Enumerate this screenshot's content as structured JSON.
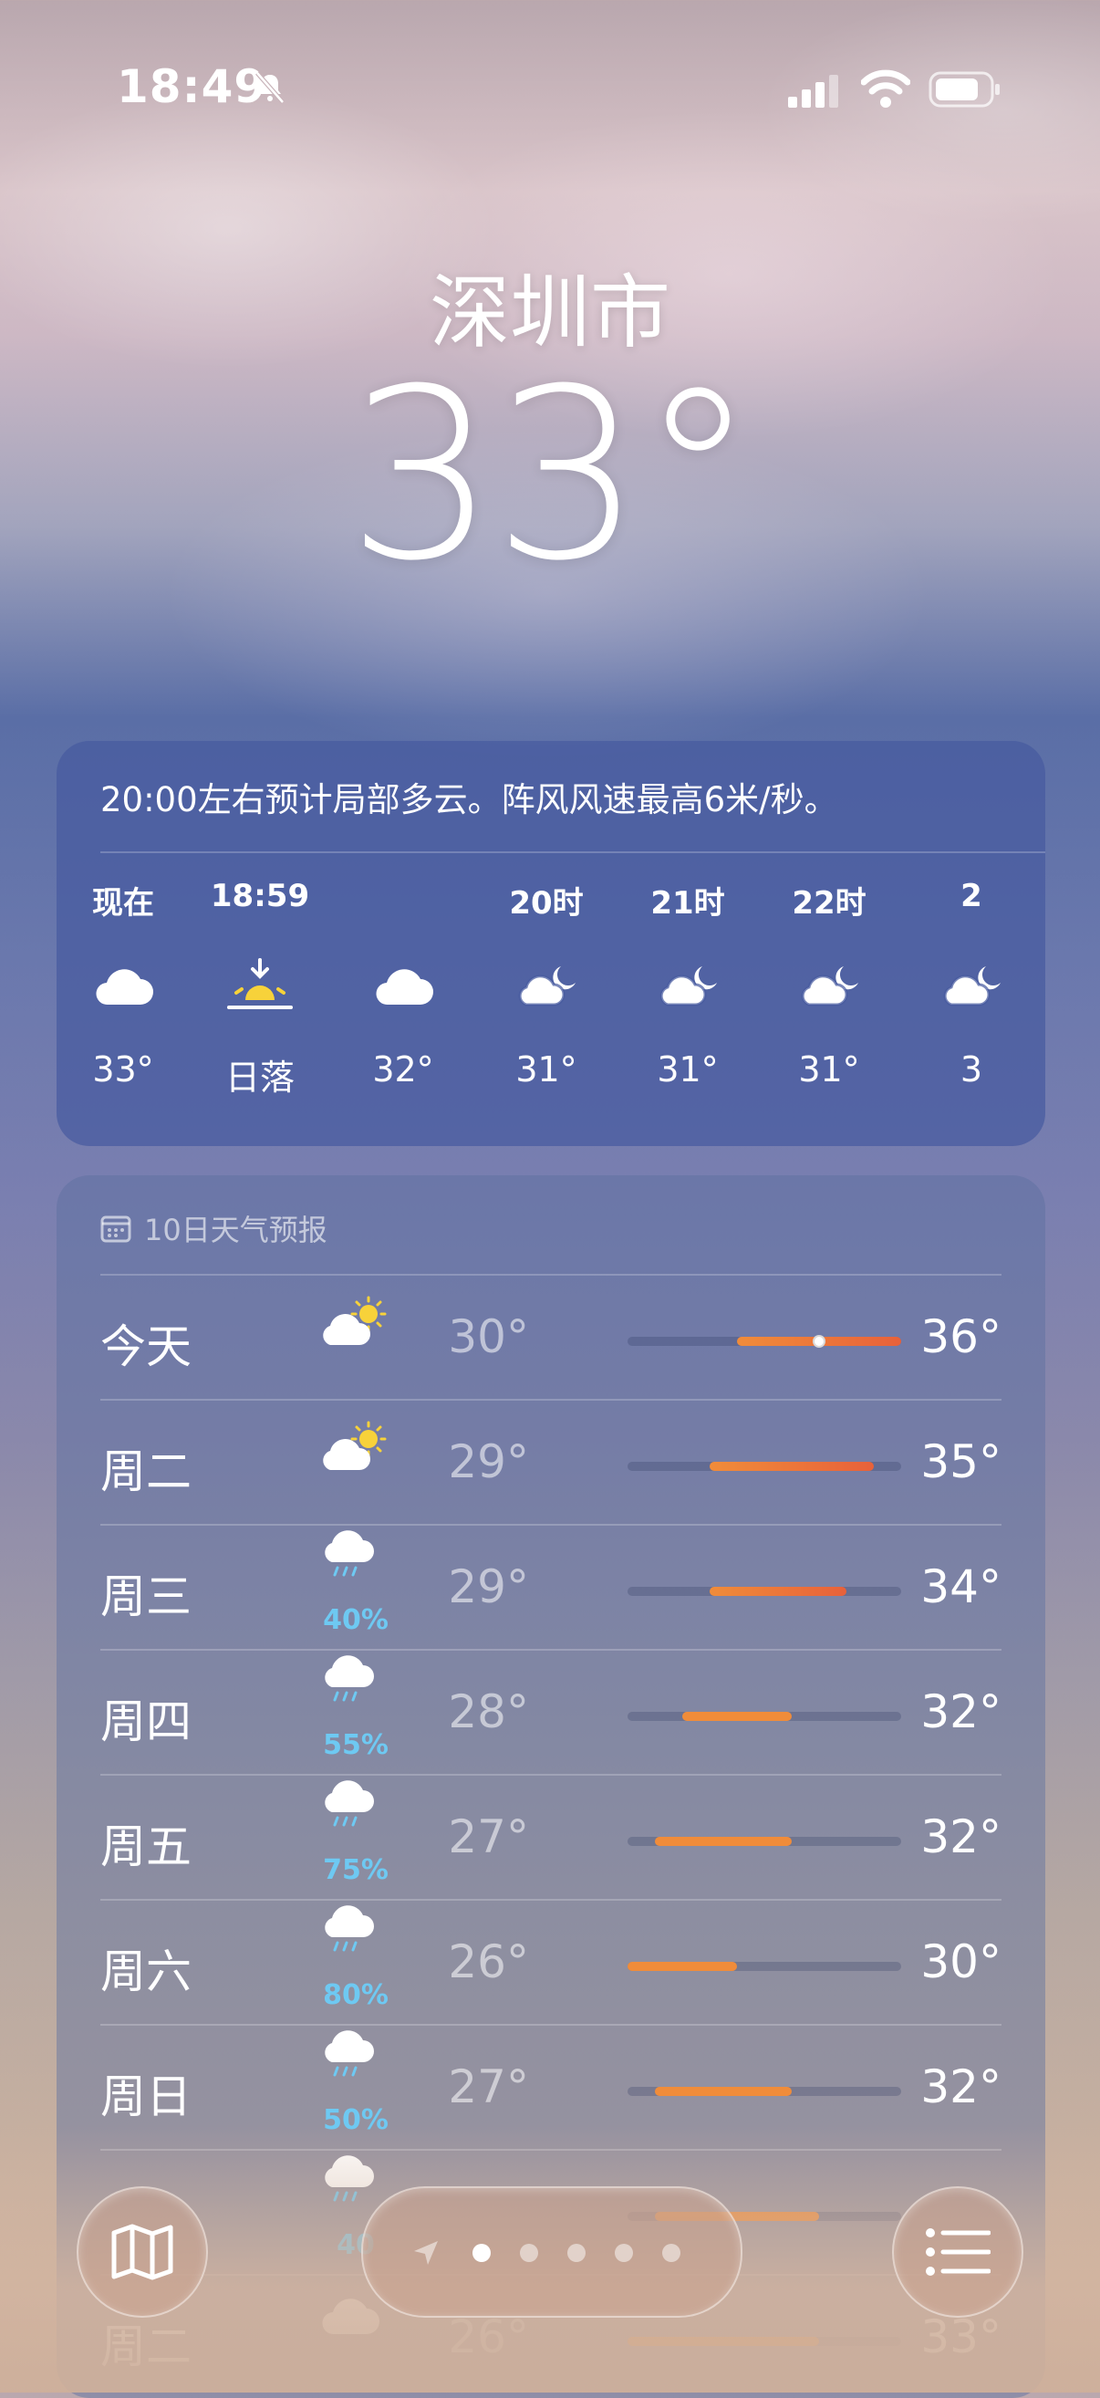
{
  "status_bar": {
    "time": "18:49"
  },
  "location": {
    "city": "深圳市",
    "temperature": "33°"
  },
  "hourly": {
    "summary": "20:00左右预计局部多云。阵风风速最高6米/秒。",
    "items": [
      {
        "label": "现在",
        "icon": "cloud-icon",
        "temp": "33°"
      },
      {
        "label": "18:59",
        "icon": "sunset-icon",
        "temp": "日落"
      },
      {
        "label": "",
        "icon": "cloud-icon",
        "temp": "32°"
      },
      {
        "label": "20时",
        "icon": "moon-cloud-icon",
        "temp": "31°"
      },
      {
        "label": "21时",
        "icon": "moon-cloud-icon",
        "temp": "31°"
      },
      {
        "label": "22时",
        "icon": "moon-cloud-icon",
        "temp": "31°"
      },
      {
        "label": "2",
        "icon": "moon-cloud-icon",
        "temp": "3"
      }
    ]
  },
  "daily": {
    "header": "10日天气预报",
    "range": [
      26,
      36
    ],
    "items": [
      {
        "day": "今天",
        "icon": "sun-cloud-icon",
        "precip": "",
        "low": "30°",
        "high": "36°",
        "low_v": 30,
        "high_v": 36,
        "current_v": 33
      },
      {
        "day": "周二",
        "icon": "sun-cloud-icon",
        "precip": "",
        "low": "29°",
        "high": "35°",
        "low_v": 29,
        "high_v": 35
      },
      {
        "day": "周三",
        "icon": "rain-icon",
        "precip": "40%",
        "low": "29°",
        "high": "34°",
        "low_v": 29,
        "high_v": 34
      },
      {
        "day": "周四",
        "icon": "rain-icon",
        "precip": "55%",
        "low": "28°",
        "high": "32°",
        "low_v": 28,
        "high_v": 32
      },
      {
        "day": "周五",
        "icon": "rain-icon",
        "precip": "75%",
        "low": "27°",
        "high": "32°",
        "low_v": 27,
        "high_v": 32
      },
      {
        "day": "周六",
        "icon": "rain-icon",
        "precip": "80%",
        "low": "26°",
        "high": "30°",
        "low_v": 26,
        "high_v": 30
      },
      {
        "day": "周日",
        "icon": "rain-icon",
        "precip": "50%",
        "low": "27°",
        "high": "32°",
        "low_v": 27,
        "high_v": 32
      },
      {
        "day": "",
        "icon": "rain-icon",
        "precip": "40",
        "low": "",
        "high": "",
        "low_v": 27,
        "high_v": 33
      },
      {
        "day": "周二",
        "icon": "cloud-icon",
        "precip": "",
        "low": "26°",
        "high": "33°",
        "low_v": 26,
        "high_v": 33
      }
    ]
  },
  "pager": {
    "count": 5,
    "active_index": 0
  },
  "colors": {
    "precip": "#6ec9f2",
    "sun": "#f7d23a",
    "hot": "#e8613a",
    "warm": "#f08c3a"
  }
}
